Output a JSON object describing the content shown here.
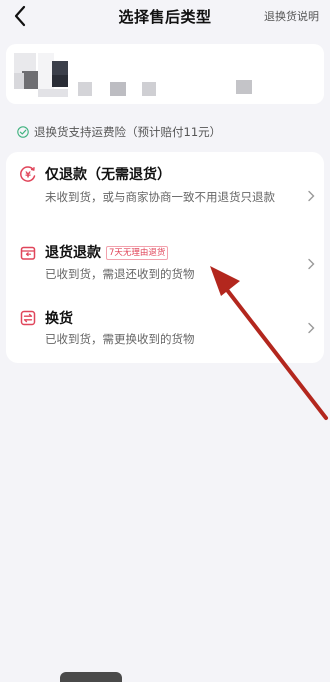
{
  "header": {
    "title": "选择售后类型",
    "help_link": "退换货说明",
    "back_icon": "chevron-left-icon"
  },
  "insurance": {
    "text": "退换货支持运费险（预计赔付11元）",
    "icon": "check-circle-icon",
    "color": "#3fb27f"
  },
  "options": [
    {
      "title": "仅退款（无需退货）",
      "desc": "未收到货，或与商家协商一致不用退货只退款",
      "icon": "refund-coin-icon",
      "badge": ""
    },
    {
      "title": "退货退款",
      "badge": "7天无理由退货",
      "desc": "已收到货，需退还收到的货物",
      "icon": "return-box-icon"
    },
    {
      "title": "换货",
      "desc": "已收到货，需更换收到的货物",
      "icon": "exchange-icon",
      "badge": ""
    }
  ],
  "colors": {
    "accent": "#e0455a",
    "arrow": "#b3271e",
    "background": "#f4f4f8"
  }
}
